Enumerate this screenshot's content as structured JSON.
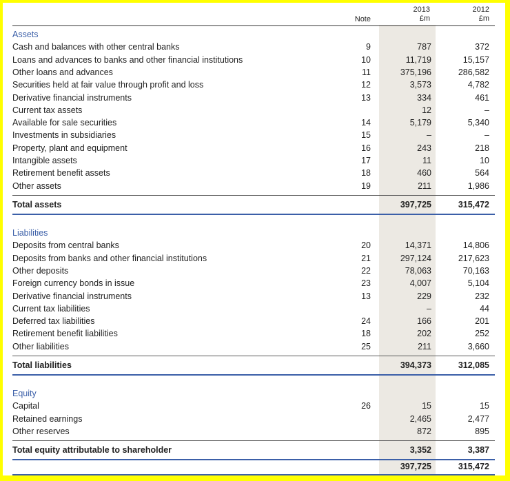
{
  "header": {
    "note": "Note",
    "year1": "2013",
    "unit1": "£m",
    "year2": "2012",
    "unit2": "£m"
  },
  "sections": [
    {
      "title": "Assets",
      "rows": [
        {
          "label": "Cash and balances with other central banks",
          "note": "9",
          "y2013": "787",
          "y2012": "372"
        },
        {
          "label": "Loans and advances to banks and other financial institutions",
          "note": "10",
          "y2013": "11,719",
          "y2012": "15,157"
        },
        {
          "label": "Other loans and advances",
          "note": "11",
          "y2013": "375,196",
          "y2012": "286,582"
        },
        {
          "label": "Securities held at fair value through profit and loss",
          "note": "12",
          "y2013": "3,573",
          "y2012": "4,782"
        },
        {
          "label": "Derivative financial instruments",
          "note": "13",
          "y2013": "334",
          "y2012": "461"
        },
        {
          "label": "Current tax assets",
          "note": "",
          "y2013": "12",
          "y2012": "–"
        },
        {
          "label": "Available for sale securities",
          "note": "14",
          "y2013": "5,179",
          "y2012": "5,340"
        },
        {
          "label": "Investments in subsidiaries",
          "note": "15",
          "y2013": "–",
          "y2012": "–"
        },
        {
          "label": "Property, plant and equipment",
          "note": "16",
          "y2013": "243",
          "y2012": "218"
        },
        {
          "label": "Intangible assets",
          "note": "17",
          "y2013": "11",
          "y2012": "10"
        },
        {
          "label": "Retirement benefit assets",
          "note": "18",
          "y2013": "460",
          "y2012": "564"
        },
        {
          "label": "Other assets",
          "note": "19",
          "y2013": "211",
          "y2012": "1,986"
        }
      ],
      "total": {
        "label": "Total assets",
        "y2013": "397,725",
        "y2012": "315,472"
      }
    },
    {
      "title": "Liabilities",
      "rows": [
        {
          "label": "Deposits from central banks",
          "note": "20",
          "y2013": "14,371",
          "y2012": "14,806"
        },
        {
          "label": "Deposits from banks and other financial institutions",
          "note": "21",
          "y2013": "297,124",
          "y2012": "217,623"
        },
        {
          "label": "Other deposits",
          "note": "22",
          "y2013": "78,063",
          "y2012": "70,163"
        },
        {
          "label": "Foreign currency bonds in issue",
          "note": "23",
          "y2013": "4,007",
          "y2012": "5,104"
        },
        {
          "label": "Derivative financial instruments",
          "note": "13",
          "y2013": "229",
          "y2012": "232"
        },
        {
          "label": "Current tax liabilities",
          "note": "",
          "y2013": "–",
          "y2012": "44"
        },
        {
          "label": "Deferred tax liabilities",
          "note": "24",
          "y2013": "166",
          "y2012": "201"
        },
        {
          "label": "Retirement benefit liabilities",
          "note": "18",
          "y2013": "202",
          "y2012": "252"
        },
        {
          "label": "Other liabilities",
          "note": "25",
          "y2013": "211",
          "y2012": "3,660"
        }
      ],
      "total": {
        "label": "Total liabilities",
        "y2013": "394,373",
        "y2012": "312,085"
      }
    },
    {
      "title": "Equity",
      "rows": [
        {
          "label": "Capital",
          "note": "26",
          "y2013": "15",
          "y2012": "15"
        },
        {
          "label": "Retained earnings",
          "note": "",
          "y2013": "2,465",
          "y2012": "2,477"
        },
        {
          "label": "Other reserves",
          "note": "",
          "y2013": "872",
          "y2012": "895"
        }
      ],
      "total": {
        "label": "Total equity attributable to shareholder",
        "y2013": "3,352",
        "y2012": "3,387"
      }
    }
  ],
  "grand_total": {
    "y2013": "397,725",
    "y2012": "315,472"
  }
}
